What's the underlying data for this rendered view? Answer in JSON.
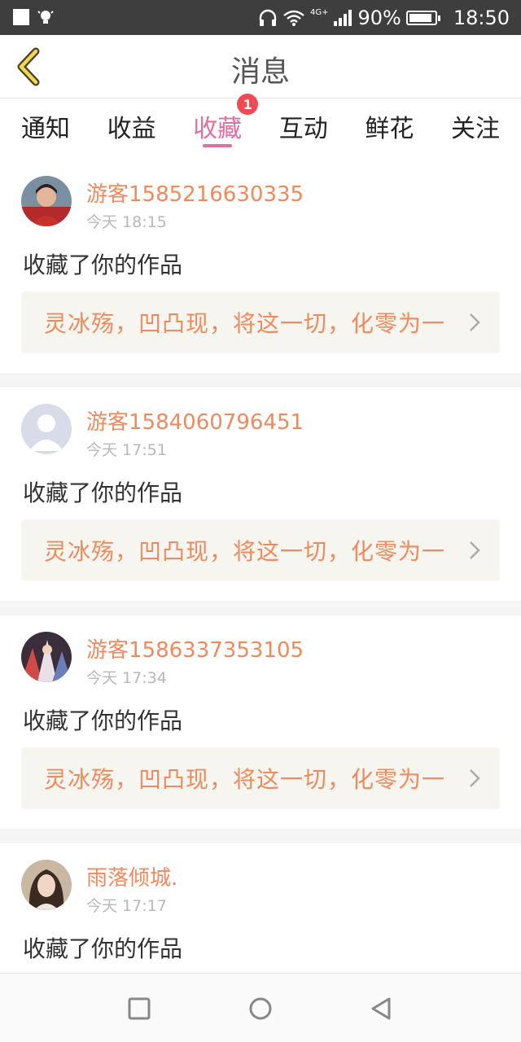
{
  "status_bar": {
    "network": "4G+",
    "battery": "90%",
    "battery_level": 0.9,
    "time": "18:50"
  },
  "header": {
    "title": "消息"
  },
  "tabs": [
    {
      "label": "通知"
    },
    {
      "label": "收益"
    },
    {
      "label": "收藏",
      "badge": "1"
    },
    {
      "label": "互动"
    },
    {
      "label": "鲜花"
    },
    {
      "label": "关注"
    }
  ],
  "feed": [
    {
      "user": "游客1585216630335",
      "time": "今天 18:15",
      "action": "收藏了你的作品",
      "work": "灵冰殇，凹凸现，将这一切，化零为一"
    },
    {
      "user": "游客1584060796451",
      "time": "今天 17:51",
      "action": "收藏了你的作品",
      "work": "灵冰殇，凹凸现，将这一切，化零为一"
    },
    {
      "user": "游客1586337353105",
      "time": "今天 17:34",
      "action": "收藏了你的作品",
      "work": "灵冰殇，凹凸现，将这一切，化零为一"
    },
    {
      "user": "雨落倾城.",
      "time": "今天 17:17",
      "action": "收藏了你的作品",
      "work": ""
    }
  ],
  "colors": {
    "accent": "#e16fa2",
    "username": "#f08a5d",
    "badge": "#f24a55"
  },
  "icons": [
    "back-icon",
    "chevron-right-icon",
    "recent-apps-icon",
    "home-icon",
    "back-nav-icon"
  ]
}
